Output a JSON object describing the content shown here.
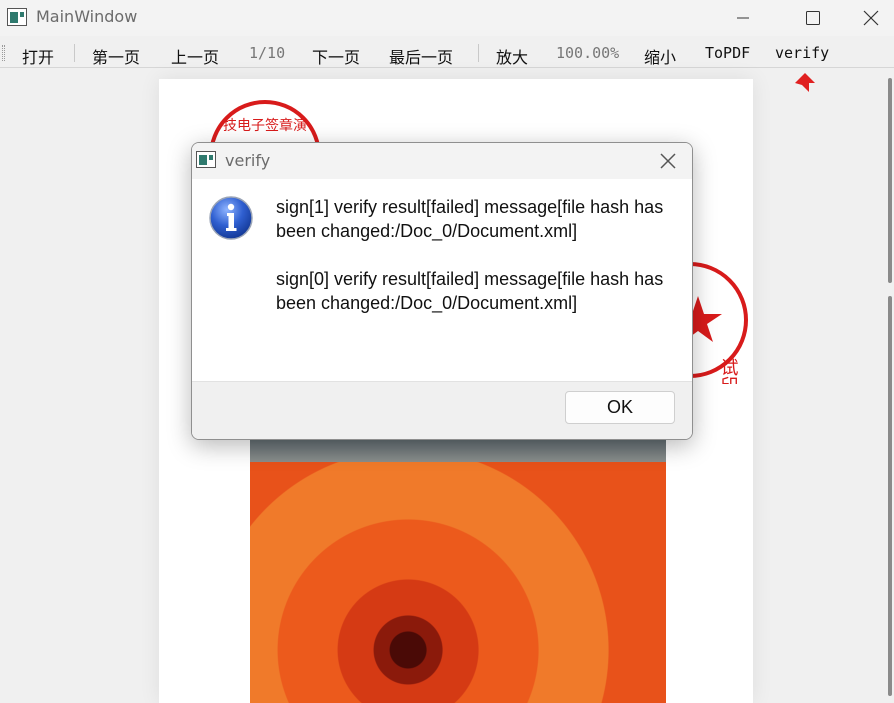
{
  "window": {
    "title": "MainWindow"
  },
  "toolbar": {
    "open": "打开",
    "first_page": "第一页",
    "prev_page": "上一页",
    "page_indicator": "1/10",
    "next_page": "下一页",
    "last_page": "最后一页",
    "zoom_in": "放大",
    "zoom_level": "100.00%",
    "zoom_out": "缩小",
    "to_pdf": "ToPDF",
    "verify": "verify"
  },
  "document": {
    "seal_top_text": "技电子签章演",
    "seal_right_text": "试印章",
    "seal_color": "#d81b1b"
  },
  "dialog": {
    "title": "verify",
    "messages": [
      "sign[1] verify result[failed] message[file hash has been changed:/Doc_0/Document.xml]",
      "sign[0] verify result[failed] message[file hash has been changed:/Doc_0/Document.xml]"
    ],
    "ok_label": "OK",
    "icon": "info-icon"
  }
}
